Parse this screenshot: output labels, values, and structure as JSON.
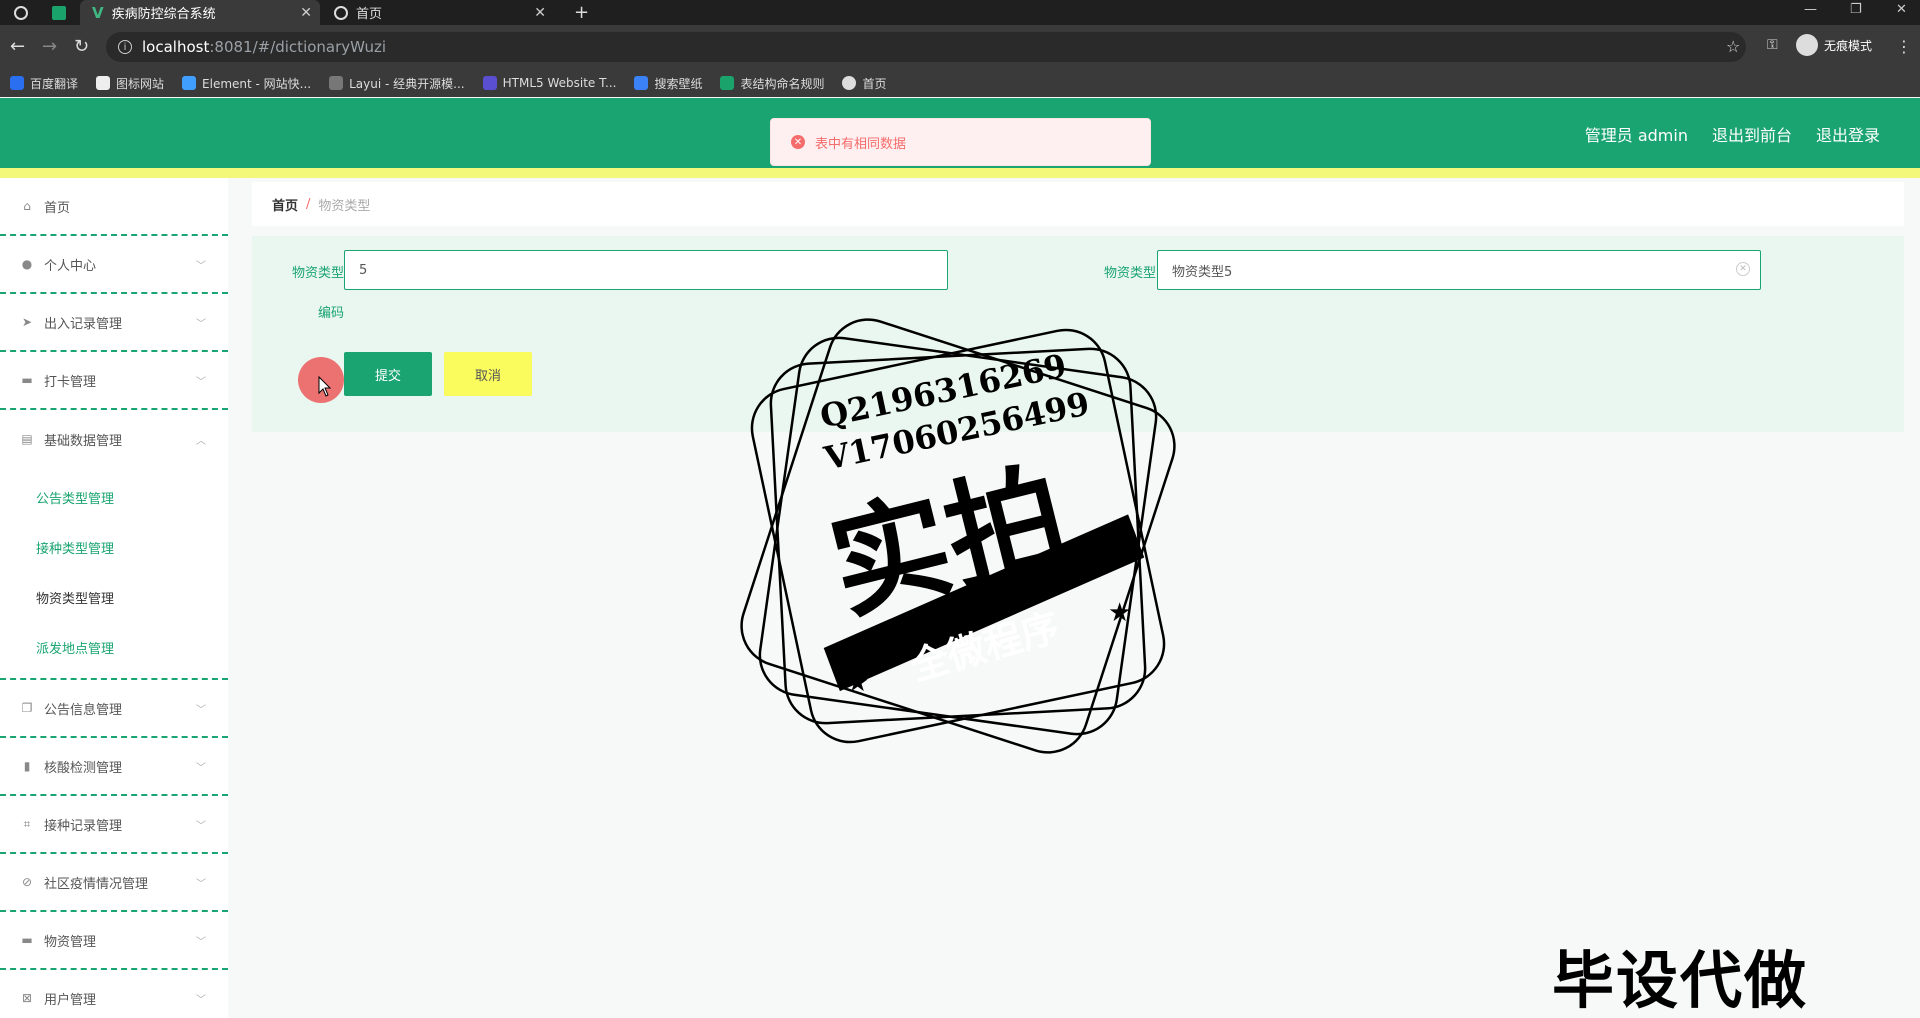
{
  "browser": {
    "tabs": [
      {
        "label": "疾病防控综合系统",
        "icon": "vue-logo-icon",
        "active": true
      },
      {
        "label": "首页",
        "icon": "globe-icon",
        "active": false
      }
    ],
    "url_host": "localhost",
    "url_path": ":8081/#/dictionaryWuzi",
    "profile_label": "无痕模式",
    "bookmarks": [
      {
        "label": "百度翻译",
        "icon_color": "#2a6ff0"
      },
      {
        "label": "图标网站",
        "icon_color": "#eeeeee"
      },
      {
        "label": "Element - 网站快...",
        "icon_color": "#409eff"
      },
      {
        "label": "Layui - 经典开源模...",
        "icon_color": "#777777"
      },
      {
        "label": "HTML5 Website T...",
        "icon_color": "#5b4fd1"
      },
      {
        "label": "搜索壁纸",
        "icon_color": "#3b82f6"
      },
      {
        "label": "表结构命名规则",
        "icon_color": "#1aa36a"
      },
      {
        "label": "首页",
        "icon_color": "#dddddd"
      }
    ]
  },
  "header": {
    "user": "管理员 admin",
    "to_front": "退出到前台",
    "logout": "退出登录"
  },
  "toast": {
    "message": "表中有相同数据",
    "color": "#f56c6c"
  },
  "sidebar": {
    "items": [
      {
        "label": "首页",
        "icon": "home-icon"
      },
      {
        "label": "个人中心",
        "icon": "user-icon"
      },
      {
        "label": "出入记录管理",
        "icon": "send-icon"
      },
      {
        "label": "打卡管理",
        "icon": "briefcase-icon"
      },
      {
        "label": "基础数据管理",
        "icon": "clipboard-icon"
      },
      {
        "label": "公告信息管理",
        "icon": "copy-icon"
      },
      {
        "label": "核酸检测管理",
        "icon": "bar-chart-icon"
      },
      {
        "label": "接种记录管理",
        "icon": "crop-icon"
      },
      {
        "label": "社区疫情情况管理",
        "icon": "no-bell-icon"
      },
      {
        "label": "物资管理",
        "icon": "box-icon"
      },
      {
        "label": "用户管理",
        "icon": "delete-box-icon"
      }
    ],
    "sub_items": [
      "公告类型管理",
      "接种类型管理",
      "物资类型管理",
      "派发地点管理"
    ]
  },
  "breadcrumb": {
    "home": "首页",
    "separator": "/",
    "current": "物资类型"
  },
  "form": {
    "code_label_1": "物资类型",
    "code_label_2": "编码",
    "code_value": "5",
    "name_label": "物资类型",
    "name_value": "物资类型5",
    "submit": "提交",
    "cancel": "取消"
  },
  "watermark": {
    "line1": "Q2196316269",
    "line2": "V17060256499",
    "big": "实拍",
    "banner": "全微程序",
    "bottom": "毕设代做"
  },
  "colors": {
    "accent": "#1aa471",
    "highlight": "#f4f87a",
    "cancel_btn": "#fafc5e"
  }
}
